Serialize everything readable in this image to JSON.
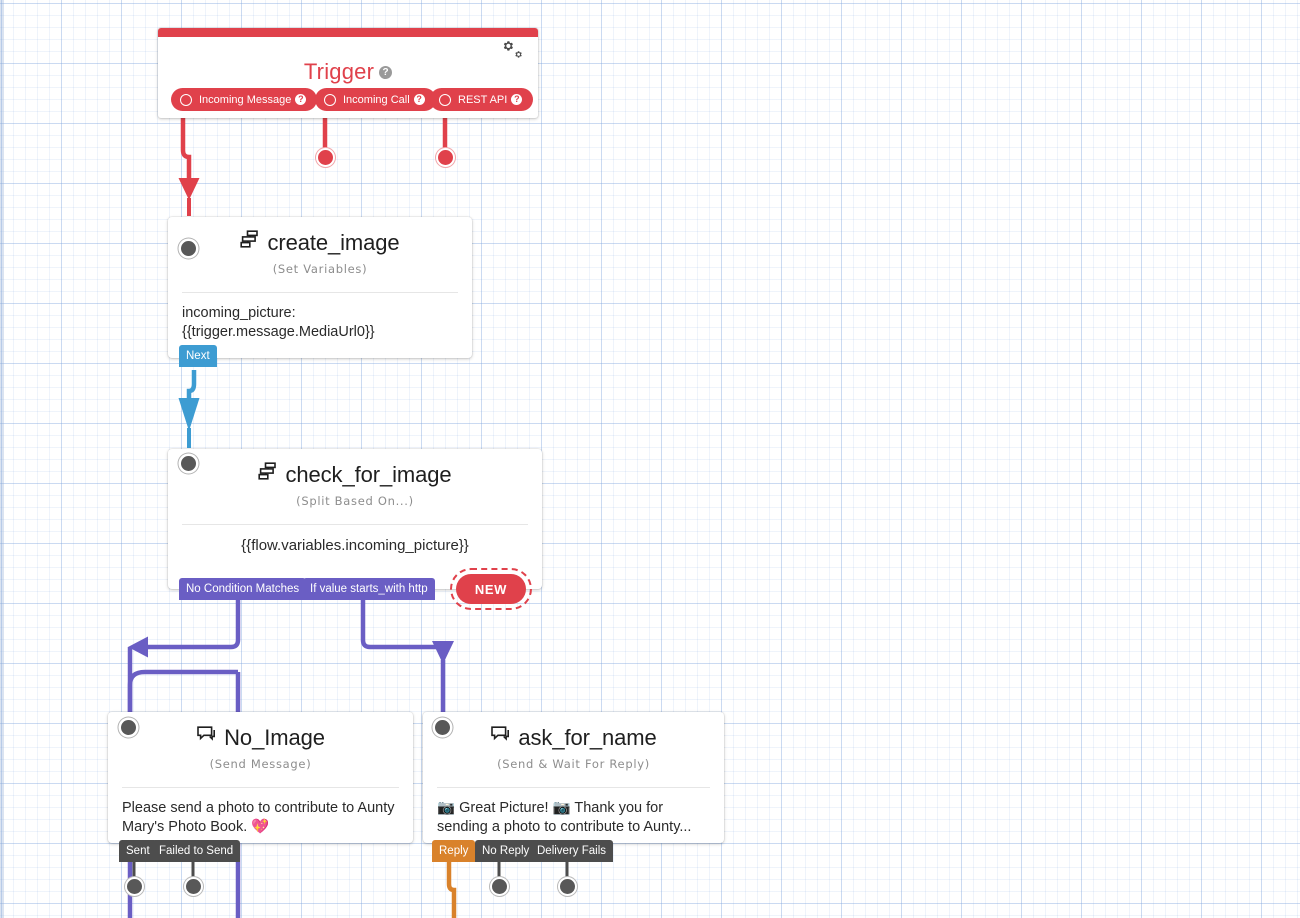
{
  "canvas": {
    "background_color": "#ffffff",
    "grid_color": "#7aa0dc"
  },
  "trigger": {
    "title": "Trigger",
    "help_glyph": "?",
    "accent_color": "#e0414b",
    "gear_icon": "gear-icon",
    "pills": [
      {
        "label": "Incoming Message",
        "help_glyph": "?"
      },
      {
        "label": "Incoming Call",
        "help_glyph": "?"
      },
      {
        "label": "REST API",
        "help_glyph": "?"
      }
    ]
  },
  "nodes": [
    {
      "id": "create_image",
      "title": "create_image",
      "icon": "set-variables-icon",
      "subtitle": "(Set Variables)",
      "body": "incoming_picture: {{trigger.message.MediaUrl0}}",
      "outputs": [
        {
          "label": "Next",
          "color": "#3d9cd2"
        }
      ]
    },
    {
      "id": "check_for_image",
      "title": "check_for_image",
      "icon": "split-based-on-icon",
      "subtitle": "(Split Based On...)",
      "body": "{{flow.variables.incoming_picture}}",
      "outputs": [
        {
          "label": "No Condition Matches",
          "color": "#6a5ec4"
        },
        {
          "label": "If value starts_with http",
          "color": "#6a5ec4"
        }
      ],
      "badge": {
        "label": "NEW",
        "color": "#e0414b"
      }
    },
    {
      "id": "No_Image",
      "title": "No_Image",
      "icon": "message-bubble-icon",
      "subtitle": "(Send Message)",
      "body": "Please send a photo to contribute to Aunty Mary's Photo Book. 💖",
      "outputs": [
        {
          "label": "Sent",
          "color": "#4d4d4d"
        },
        {
          "label": "Failed to Send",
          "color": "#4d4d4d"
        }
      ]
    },
    {
      "id": "ask_for_name",
      "title": "ask_for_name",
      "icon": "message-bubble-icon",
      "subtitle": "(Send & Wait For Reply)",
      "body": "📷 Great Picture! 📷 Thank you for sending a photo to contribute to Aunty...",
      "outputs": [
        {
          "label": "Reply",
          "color": "#d9822b"
        },
        {
          "label": "No Reply",
          "color": "#4d4d4d"
        },
        {
          "label": "Delivery Fails",
          "color": "#4d4d4d"
        }
      ]
    }
  ],
  "connectors": [
    {
      "from": "Incoming Message",
      "to": "create_image",
      "color": "#e0414b"
    },
    {
      "from": "Next",
      "to": "check_for_image",
      "color": "#3d9cd2"
    },
    {
      "from": "No Condition Matches",
      "to": "No_Image",
      "color": "#6a5ec4"
    },
    {
      "from": "If value starts_with http",
      "to": "ask_for_name",
      "color": "#6a5ec4"
    }
  ]
}
